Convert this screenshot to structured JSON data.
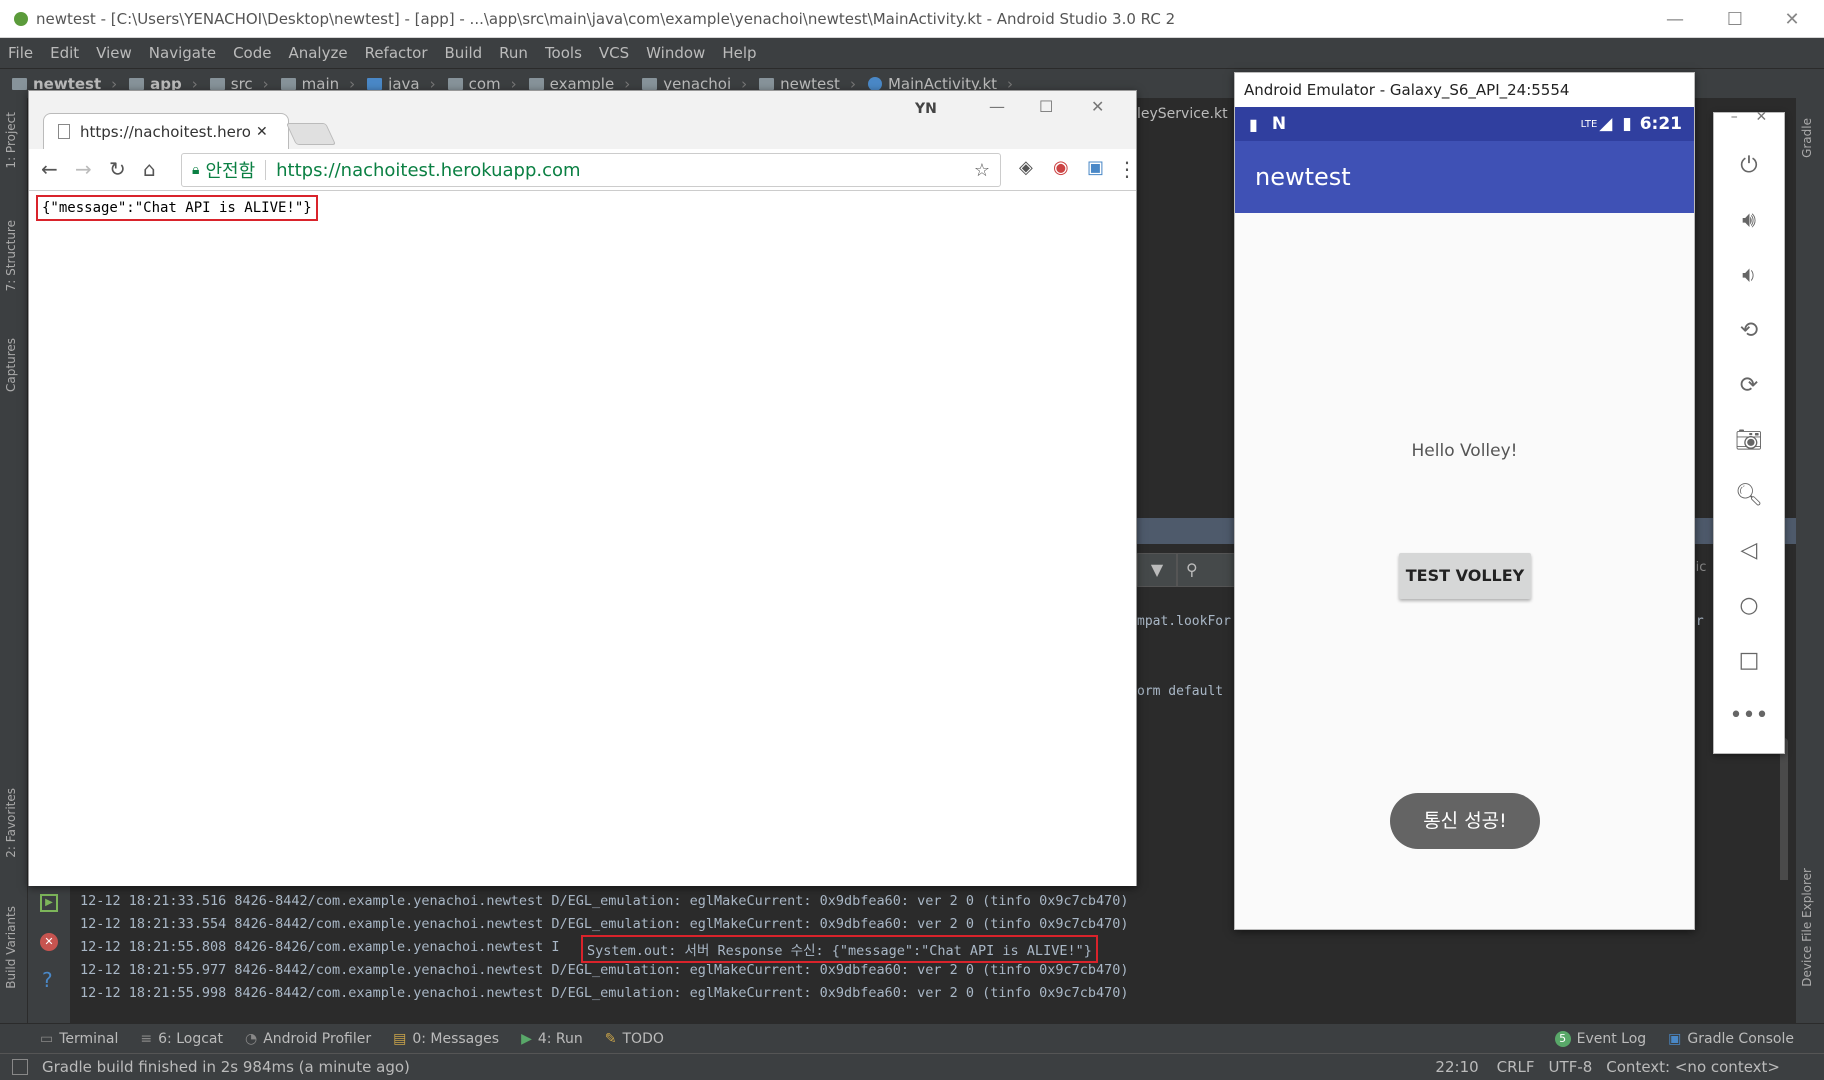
{
  "as_title": "newtest - [C:\\Users\\YENACHOI\\Desktop\\newtest] - [app] - ...\\app\\src\\main\\java\\com\\example\\yenachoi\\newtest\\MainActivity.kt - Android Studio 3.0 RC 2",
  "menu": [
    "File",
    "Edit",
    "View",
    "Navigate",
    "Code",
    "Analyze",
    "Refactor",
    "Build",
    "Run",
    "Tools",
    "VCS",
    "Window",
    "Help"
  ],
  "breadcrumb": [
    "newtest",
    "app",
    "src",
    "main",
    "java",
    "com",
    "example",
    "yenachoi",
    "newtest",
    "MainActivity.kt"
  ],
  "left_tabs": [
    "1: Project",
    "7: Structure",
    "Captures",
    "2: Favorites",
    "Build Variants"
  ],
  "right_tabs": [
    "Gradle",
    "Device File Explorer"
  ],
  "editor_fragments": {
    "file_tab": "leyService.kt",
    "code1": "mpat.lookFor",
    "code2": "orm default",
    "code3": "er",
    "code4": "lic"
  },
  "chrome": {
    "tab_title": "https://nachoitest.heroku",
    "secure_label": "안전함",
    "url": "https://nachoitest.herokuapp.com",
    "profile": "YN",
    "body_text": "{\"message\":\"Chat API is ALIVE!\"}"
  },
  "logcat": [
    "12-12 18:21:33.516 8426-8442/com.example.yenachoi.newtest D/EGL_emulation: eglMakeCurrent: 0x9dbfea60: ver 2 0 (tinfo 0x9c7cb470)",
    "12-12 18:21:33.554 8426-8442/com.example.yenachoi.newtest D/EGL_emulation: eglMakeCurrent: 0x9dbfea60: ver 2 0 (tinfo 0x9c7cb470)",
    "12-12 18:21:55.808 8426-8426/com.example.yenachoi.newtest I",
    "12-12 18:21:55.977 8426-8442/com.example.yenachoi.newtest D/EGL_emulation: eglMakeCurrent: 0x9dbfea60: ver 2 0 (tinfo 0x9c7cb470)",
    "12-12 18:21:55.998 8426-8442/com.example.yenachoi.newtest D/EGL_emulation: eglMakeCurrent: 0x9dbfea60: ver 2 0 (tinfo 0x9c7cb470)"
  ],
  "logcat_highlight": "System.out: 서버 Response 수신: {\"message\":\"Chat API is ALIVE!\"}",
  "bottom_tabs": [
    "Terminal",
    "6: Logcat",
    "Android Profiler",
    "0: Messages",
    "4: Run",
    "TODO"
  ],
  "bottom_right_tabs": [
    "Event Log",
    "Gradle Console"
  ],
  "event_badge": "5",
  "status": {
    "message": "Gradle build finished in 2s 984ms (a minute ago)",
    "position": "22:10",
    "line_sep": "CRLF",
    "encoding": "UTF-8",
    "context": "Context: <no context>"
  },
  "emulator": {
    "title": "Android Emulator - Galaxy_S6_API_24:5554",
    "time": "6:21",
    "network": "LTE",
    "app_title": "newtest",
    "hello": "Hello Volley!",
    "button": "TEST VOLLEY",
    "toast": "통신 성공!"
  },
  "colors": {
    "accent": "#3f51b5",
    "status_bar": "#303f9f",
    "highlight": "#d9232b"
  }
}
